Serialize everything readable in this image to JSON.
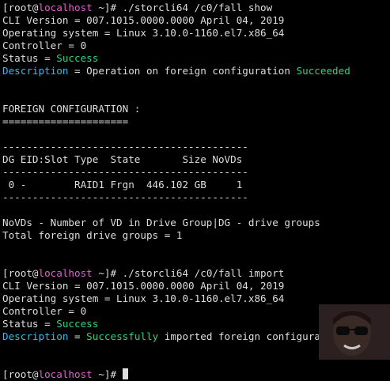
{
  "session1": {
    "prompt_user": "[root@",
    "prompt_host": "localhost",
    "prompt_suffix": " ~]# ",
    "command": "./storcli64 /c0/fall show",
    "cli_version": "CLI Version = 007.1015.0000.0000 April 04, 2019",
    "os": "Operating system = Linux 3.10.0-1160.el7.x86_64",
    "controller": "Controller = 0",
    "status_key": "Status = ",
    "status_value": "Success",
    "desc_key": "Description",
    "desc_text": " = Operation on foreign configuration ",
    "desc_value": "Succeeded"
  },
  "foreign": {
    "heading": "FOREIGN CONFIGURATION :",
    "underline": "=====================",
    "divider": "-----------------------------------------",
    "header": "DG EID:Slot Type  State       Size NoVDs",
    "row": " 0 -        RAID1 Frgn  446.102 GB     1",
    "legend": "NoVDs - Number of VD in Drive Group|DG - drive groups",
    "total": "Total foreign drive groups = 1"
  },
  "session2": {
    "prompt_user": "[root@",
    "prompt_host": "localhost",
    "prompt_suffix": " ~]# ",
    "command": "./storcli64 /c0/fall import",
    "cli_version": "CLI Version = 007.1015.0000.0000 April 04, 2019",
    "os": "Operating system = Linux 3.10.0-1160.el7.x86_64",
    "controller": "Controller = 0",
    "status_key": "Status = ",
    "status_value": "Success",
    "desc_key": "Description",
    "desc_eq": " = ",
    "desc_value": "Successfully",
    "desc_text": " imported foreign configuration"
  },
  "prompt3": {
    "prompt_user": "[root@",
    "prompt_host": "localhost",
    "prompt_suffix": " ~]# "
  },
  "colors": {
    "background": "#000000",
    "text": "#dedede",
    "hostname": "#e05fcf",
    "success": "#33d17a",
    "description": "#3fb7e8"
  }
}
